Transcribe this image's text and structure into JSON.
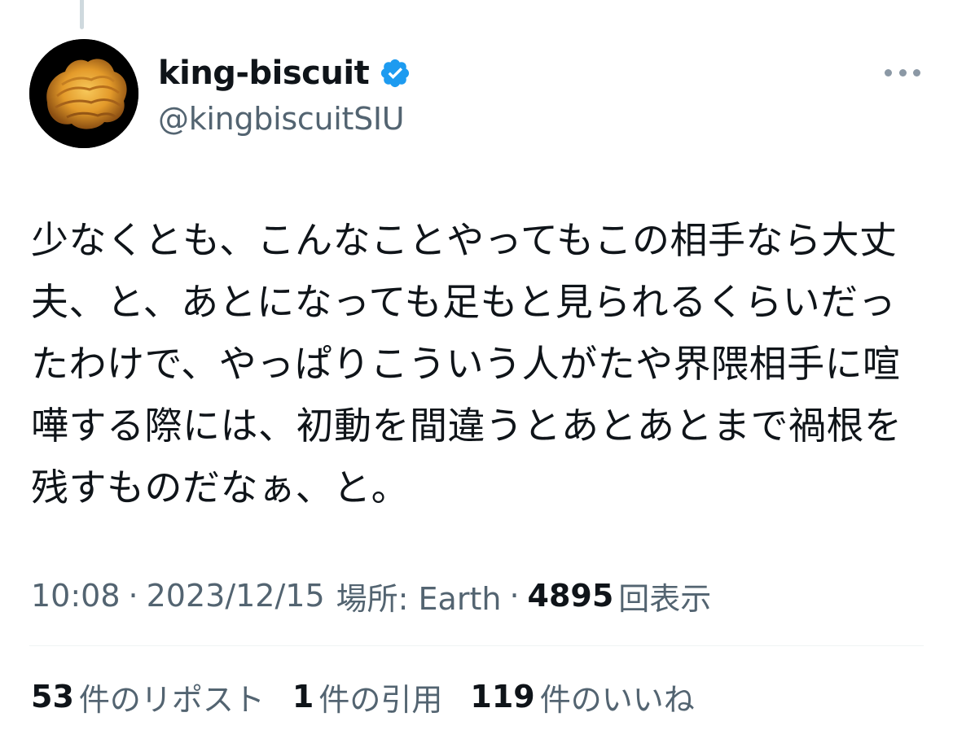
{
  "tweet": {
    "author": {
      "display_name": "king-biscuit",
      "handle": "@kingbiscuitSIU",
      "verified": true,
      "avatar_icon": "croissant-photo-avatar"
    },
    "more_icon": "more-horizontal-icon",
    "body_lines": [
      "少なくとも、こんなことやってもこの相手なら大丈",
      "夫、と、あとになっても足もと見られるくらいだっ",
      "たわけで、やっぱりこういう人がたや界隈相手に喧",
      "嘩する際には、初動を間違うとあとあとまで禍根を",
      "残すものだなぁ、と。"
    ],
    "meta": {
      "time": "10:08",
      "separator": "·",
      "date": "2023/12/15",
      "location": "場所: Earth",
      "views_count": "4895",
      "views_label": "回表示"
    },
    "stats": {
      "reposts_count": "53",
      "reposts_label": "件のリポスト",
      "quotes_count": "1",
      "quotes_label": "件の引用",
      "likes_count": "119",
      "likes_label": "件のいいね"
    }
  },
  "colors": {
    "text_primary": "#0f1419",
    "text_secondary": "#536471",
    "verified_blue": "#1d9bf0",
    "divider": "#eff3f4"
  }
}
